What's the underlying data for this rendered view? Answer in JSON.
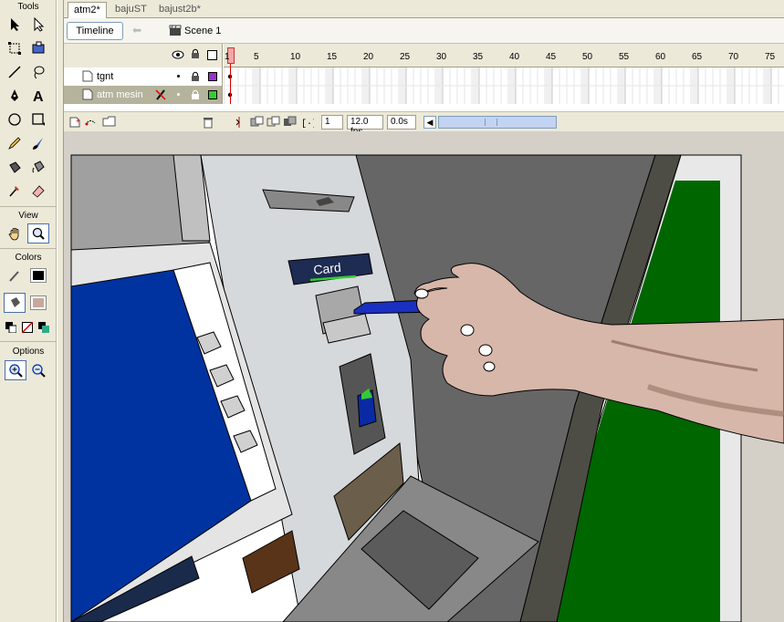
{
  "tools_panel": {
    "title": "Tools",
    "view_title": "View",
    "colors_title": "Colors",
    "options_title": "Options",
    "stroke_color": "#000000",
    "fill_color": "#c8a89c"
  },
  "tabs": [
    {
      "label": "atm2*",
      "active": true
    },
    {
      "label": "bajuST",
      "active": false
    },
    {
      "label": "bajust2b*",
      "active": false
    }
  ],
  "editbar": {
    "timeline_label": "Timeline",
    "scene_label": "Scene 1"
  },
  "timeline": {
    "layers": [
      {
        "name": "tgnt",
        "color": "#9933cc",
        "selected": false
      },
      {
        "name": "atm mesin",
        "color": "#33cc33",
        "selected": true
      }
    ],
    "frame_numbers": [
      "1",
      "5",
      "10",
      "15",
      "20",
      "25",
      "30",
      "35",
      "40",
      "45",
      "50",
      "55",
      "60",
      "65",
      "70",
      "75"
    ],
    "current_frame": "1",
    "fps": "12.0 fps",
    "elapsed": "0.0s"
  },
  "stage": {
    "card_label": "Card",
    "colors": {
      "screen": "#0033a0",
      "green_panel": "#006600",
      "skin": "#d8b8a8",
      "card": "#1a30c0"
    }
  }
}
